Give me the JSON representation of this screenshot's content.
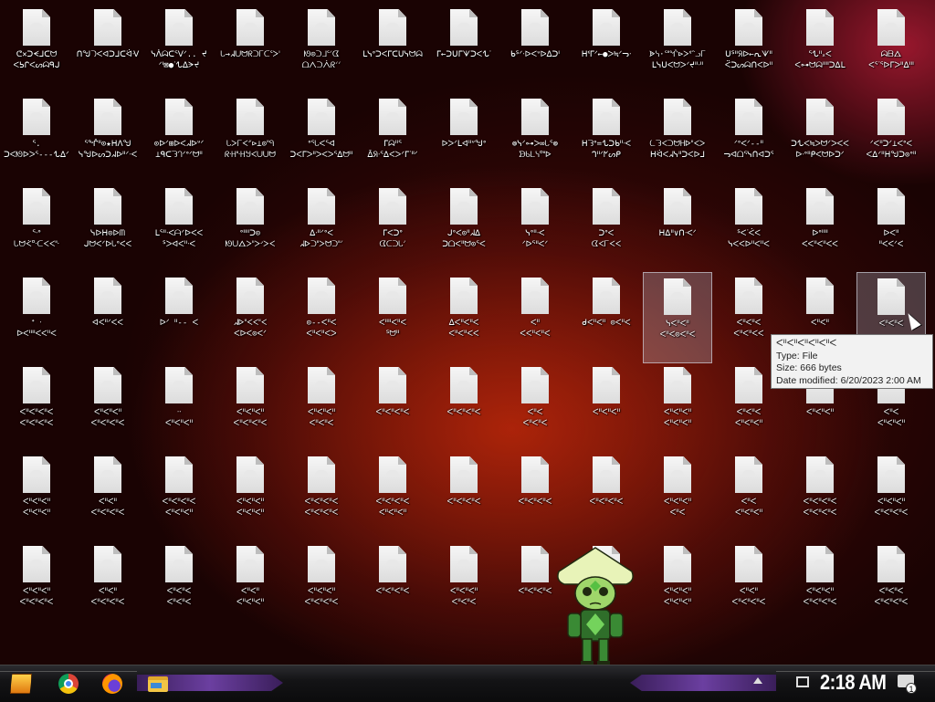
{
  "desktop": {
    "rows": [
      [
        {
          "line1": "ᕦ✕ᑐᗕᒧᑕᗢ",
          "line2": "ᐸᕊᒋᐸᔕᗣᑫᒍ"
        },
        {
          "line1": "ᑎᖑᘄᐸᐊᑐᒧᑕᐛᐺ",
          "line2": ""
        },
        {
          "line1": "ᓭᐲᗣᑕᕐᐯᐟ.. ᔪ",
          "line2": "ᐟᑊ⊠●ᐝᖍᐃᗒᔪ"
        },
        {
          "line1": "ᘂ→ᖽᑌᗢᖇᑐᒥᑕᕐᐳᑊ",
          "line2": ""
        },
        {
          "line1": "ᘚ⊙ᑐᒧᕐᐟᗧ",
          "line2": "ᗝᐱᑐᐲᖇᐟᐟ"
        },
        {
          "line1": "ᒪᓭᐤᑐᐸᒥᑕᑌᓭᗢᗣ",
          "line2": ""
        },
        {
          "line1": "ᒥ←ᑐᑌᒥᗐᑐᐸᖍᐝ",
          "line2": ""
        },
        {
          "line1": "ᑲᔆᐟᐧᐅᐸᐡᐅᐃᑐᑊ",
          "line2": ""
        },
        {
          "line1": "ᕼᓫᒥᐟ←●ᐳ≒ᐟᓓᐧ",
          "line2": ""
        },
        {
          "line1": "ᗎᓭ·ᕐᐦᖎ⊳ᐳᓫᐢᓗᒥ",
          "line2": "ᒪᓭᑌᐸᗢᐳᐟᔪᐦᐧᐦ"
        },
        {
          "line1": "ᑌᔆᐦᖆᐅ←ᕆᗐᐦ",
          "line2": "ᑈᑐᔕᗣᑎᐸᐅᐦ"
        },
        {
          "line1": "ᕐᖍᐦ᙮ᐸ",
          "line2": "ᐸ⊶ᗢᗣᐦᐦᑐᐃᒪ"
        },
        {
          "line1": "ᗣᗷᐃ",
          "line2": "ᐸᕐᐝᕐᐅᒥᐳᐦᐃᐦᑊ"
        }
      ],
      [
        {
          "line1": "ᕐ.",
          "line2": "ᑐᐸᘚᐅᐳᕐ---ᖍᐃᐟ"
        },
        {
          "line1": "ᕐᖎᐦ⊙★ᕼᐱᖑ",
          "line2": "ᓭᖑᐅᔕᑐᖽᐅᐦᐟᐧᐸ"
        },
        {
          "line1": "⊙ᐅᐟ⊞ᐅᐸᖽᐅᐡᐟ",
          "line2": "⊥ᑫᑕᘊᘃᐟᐤᐟᗢᐦ"
        },
        {
          "line1": "ᘂᐳᒥᐸᐥ⊳⊥⊙ᐦᑫ",
          "line2": "ᖇᐧᕼᐦᐧᕼᖑᐸᑌᑌᗢ"
        },
        {
          "line1": "ᐤᕐᘂᐸᕐᐊ",
          "line2": "ᑐᐸᒥᐳᐦᐳᐸᐳᕐᐃᗢᐦ"
        },
        {
          "line1": "ᒥᗣᐦᕐ",
          "line2": "ᐂᖆᐧᕐᐃᐸᐳᐟᒥᐝᐦᐟ"
        },
        {
          "line1": "ᐅᐳᐟᒪᐊᐦᐡᖑᐤ",
          "line2": ""
        },
        {
          "line1": "⊚ᓭᐟ⊶ᐳ∞ᘂᕐ⊚",
          "line2": "ᗦᑲᒪᓭᐤᐦᐅ"
        },
        {
          "line1": "ᕼᘊᐤ=ᖍᑐᑲᐦᐧᐸ",
          "line2": "ᒉᐦᐟᖼᔕᑭ"
        },
        {
          "line1": "ᘇᘊᐸᑐᗢᕼᐅᐦᐸᐳ",
          "line2": "ᕼᐛᐸᖽᓭᐦᑐᐸᐅᒧ"
        },
        {
          "line1": "ᐟᐤᐸᐟ--ᐦ",
          "line2": "ᓓᐊᗝᕐᓭᑎᐊᑐᕐ"
        },
        {
          "line1": "ᑐᖍᐸ≒ᐳᗢᐟᐳᐸᐸ",
          "line2": "ᐅᐧᐤᐦᑭᐸᗢᐅᑐᐟ"
        },
        {
          "line1": "ᐟᐸᐦᑐᐟ⊥ᐸᐤᐸ",
          "line2": "ᐸᐃᐟᐦᕼᖑᑐ⊙ᐤᐦ"
        }
      ],
      [
        {
          "line1": "ᕐᐧᐤ",
          "line2": "ᘂᗢᐹᐤᐧᑕᐸᐸᐦᐧ"
        },
        {
          "line1": "ᓭᐅᕼ⊙ᐅᗰ",
          "line2": "ᒍᗢᐸᐟᐅᘂᐤᐸᐸ"
        },
        {
          "line1": "ᒪᕐᐦᐧᐸᗩᐟᐅᐸᐸ",
          "line2": "ᔆᐳᐊᐸᐦᐧᐸ"
        },
        {
          "line1": "ᐤᐦᐦᑐ⊙",
          "line2": "ᘚᑌᐃᐳᐦᐳᐝᐳᐸ"
        },
        {
          "line1": "ᐃᐧᐦᐟᐤᐸ",
          "line2": "ᖽᐅᑐᐦᐳᗢᑐᐦᐟ"
        },
        {
          "line1": "ᒥᐸᑐᐤ",
          "line2": "ᗧᑕᑐᘂᐟ"
        },
        {
          "line1": "ᒍᐤᐸ⊙ᐦᖽᐃ",
          "line2": "ᑐᗝᐸᐦᗢ⊙ᕐᐸ"
        },
        {
          "line1": "ᓭᐤᐦᐧᐸ",
          "line2": "ᐟᐅᕐᐦᐸᐟ"
        },
        {
          "line1": "ᑐᐤᐸ",
          "line2": "ᗧᐸᒥᐸᐸ"
        },
        {
          "line1": "ᕼᐃᐦ∨ᑎᐧᐸᐟ",
          "line2": ""
        },
        {
          "line1": "ᔆᐸᐝᐹᐸ",
          "line2": "ᓭᐸᐸᐅᐦᐸᐦᐸ"
        },
        {
          "line1": "ᐅᐤᐦᐦ",
          "line2": "ᐸᐸᐦᐸᐦᐸᐸ"
        },
        {
          "line1": "ᐅᐸᐦ",
          "line2": "ᐦᐸᐸᐟᐸ"
        }
      ],
      [
        {
          "line1": "ᐩ ᐧ",
          "line2": "ᐅᐸᐦᐦᐸᐸᐦᐸ"
        },
        {
          "line1": "ᐊᐸᐦᐟᐸᐸ",
          "line2": ""
        },
        {
          "line1": "ᐅᐟ ᐦ-- ᐸ",
          "line2": ""
        },
        {
          "line1": "ᖽᐅᐦᐸᐸᐦᐸ",
          "line2": "ᐸᐅᐸ⊙ᐸᐟ"
        },
        {
          "line1": "⊙--ᐸᐦᐸ",
          "line2": "ᐸᐦᐸᐦᐸᐳ"
        },
        {
          "line1": "ᐸᐦᐦᐸᐦᐸ",
          "line2": "ᔆᗢᐦ"
        },
        {
          "line1": "ᐃᐸᐦᐸᐦᐸ",
          "line2": "ᐸᐦᐸᐦᐸᐸ"
        },
        {
          "line1": "ᐸᐦ",
          "line2": "ᐸᐸᐦᐸᐦᐸ"
        },
        {
          "line1": "ᑯᐸᐦᐸᐦ ⊙ᐸᐦᐸ",
          "line2": ""
        },
        {
          "line1": "ᓭᐸᐦᐸᐦ",
          "line2": "ᐸᐦᐸ⊙ᐸᐦᐸ"
        },
        {
          "line1": "ᐸᐦᐸᐦᐸ",
          "line2": "ᐸᐦᐸᐦᐸᐸ"
        },
        {
          "line1": "ᐸᐦᐸᐦ",
          "line2": ""
        },
        {
          "line1": "ᐸᐦᐸᐦᐸ",
          "line2": ""
        }
      ],
      [
        {
          "line1": "ᐸᐦᐸᐦᐸᐦᐸ",
          "line2": "ᐸᐦᐸᐦᐸᐦᐸ"
        },
        {
          "line1": "ᐸᐦᐸᐦᐸᐦ",
          "line2": "ᐸᐦᐸᐦᐸᐦᐸ"
        },
        {
          "line1": "ᐧᐧ",
          "line2": "ᐸᐦᐸᐦᐸᐦ"
        },
        {
          "line1": "ᐸᐦᐸᐦᐸᐦ",
          "line2": "ᐸᐦᐸᐦᐸᐦᐸ"
        },
        {
          "line1": "ᐸᐦᐸᐦᐸᐦ",
          "line2": "ᐸᐦᐸᐦᐸ"
        },
        {
          "line1": "ᐸᐦᐸᐦᐸᐦᐸ",
          "line2": ""
        },
        {
          "line1": "ᐸᐦᐸᐦᐸᐦᐸ",
          "line2": ""
        },
        {
          "line1": "ᐸᐦᐸ",
          "line2": "ᐸᐦᐸᐦᐸ"
        },
        {
          "line1": "ᐸᐦᐸᐦᐸᐦ",
          "line2": ""
        },
        {
          "line1": "ᐸᐦᐸᐦᐸᐦ",
          "line2": "ᐸᐦᐸᐦᐸᐦ"
        },
        {
          "line1": "ᐸᐦᐸᐦᐸ",
          "line2": "ᐸᐦᐸᐦᐸᐦ"
        },
        {
          "line1": "ᐸᐦᐸᐦᐸᐦ",
          "line2": ""
        },
        {
          "line1": "ᐸᐦᐸ",
          "line2": "ᐸᐦᐸᐦᐸᐦ"
        }
      ],
      [
        {
          "line1": "ᐸᐦᐸᐦᐸᐦ",
          "line2": "ᐸᐦᐸᐦᐸᐦ"
        },
        {
          "line1": "ᐸᐦᐸᐦ",
          "line2": "ᐸᐦᐸᐦᐸᐦᐸ"
        },
        {
          "line1": "ᐸᐦᐸᐦᐸᐦᐸ",
          "line2": "ᐸᐦᐸᐦᐸᐦ"
        },
        {
          "line1": "ᐸᐦᐸᐦᐸᐦ",
          "line2": "ᐸᐦᐸᐦᐸᐦ"
        },
        {
          "line1": "ᐸᐦᐸᐦᐸᐦᐸ",
          "line2": "ᐸᐦᐸᐦᐸᐦᐸ"
        },
        {
          "line1": "ᐸᐦᐸᐦᐸᐦᐸ",
          "line2": "ᐸᐦᐸᐦᐸᐦ"
        },
        {
          "line1": "ᐸᐦᐸᐦᐸᐦᐸ",
          "line2": ""
        },
        {
          "line1": "ᐸᐦᐸᐦᐸᐦᐸ",
          "line2": ""
        },
        {
          "line1": "ᐸᐦᐸᐦᐸᐦᐸ",
          "line2": ""
        },
        {
          "line1": "ᐸᐦᐸᐦᐸᐦ",
          "line2": "ᐸᐦᐸ"
        },
        {
          "line1": "ᐸᐦᐸ",
          "line2": "ᐸᐦᐸᐦᐸᐦ"
        },
        {
          "line1": "ᐸᐦᐸᐦᐸᐦᐸ",
          "line2": "ᐸᐦᐸᐦᐸᐦᐸ"
        },
        {
          "line1": "ᐸᐦᐸᐦᐸᐦ",
          "line2": "ᐸᐦᐸᐦᐸᐦᐸ"
        }
      ],
      [
        {
          "line1": "ᐸᐦᐸᐦᐸᐦ",
          "line2": "ᐸᐦᐸᐦᐸᐦᐸ"
        },
        {
          "line1": "ᐸᐦᐸᐦ",
          "line2": "ᐸᐦᐸᐦᐸᐦᐸ"
        },
        {
          "line1": "ᐸᐦᐸᐦᐸ",
          "line2": "ᐸᐦᐸᐦᐸ"
        },
        {
          "line1": "ᐸᐦᐸᐦ",
          "line2": "ᐸᐦᐸᐦᐸᐦ"
        },
        {
          "line1": "ᐸᐦᐸᐦᐸᐦ",
          "line2": "ᐸᐦᐸᐦᐸᐦᐸ"
        },
        {
          "line1": "ᐸᐦᐸᐦᐸᐦᐸ",
          "line2": ""
        },
        {
          "line1": "ᐸᐦᐸᐦᐸᐦ",
          "line2": "ᐸᐦᐸᐦᐸ"
        },
        {
          "line1": "ᐸᐦᐸᐦᐸᐦᐸ",
          "line2": ""
        },
        {
          "line1": "",
          "line2": ""
        },
        {
          "line1": "ᐸᐦᐸᐦᐸᐦ",
          "line2": "ᐸᐦᐸᐦᐸᐦ"
        },
        {
          "line1": "ᐸᐦᐸᐦ",
          "line2": "ᐸᐦᐸᐦᐸᐦᐸ"
        },
        {
          "line1": "ᐸᐦᐸᐦᐸᐦ",
          "line2": "ᐸᐦᐸᐦᐸᐦᐸ"
        },
        {
          "line1": "ᐸᐦᐸᐦᐸ",
          "line2": "ᐸᐦᐸᐦᐸᐦᐸ"
        }
      ]
    ],
    "selected": [
      [
        3,
        9
      ],
      [
        3,
        12
      ]
    ]
  },
  "tooltip": {
    "title": "ᐸᐦᐸᐦᐸᐦᐸᐦᐸᐦᐸ",
    "type_line": "Type: File",
    "size_line": "Size: 666 bytes",
    "date_line": "Date modified: 6/20/2023 2:00 AM"
  },
  "taskbar": {
    "clock": "2:18 AM",
    "notification_count": "1",
    "pinned": [
      "start-icon",
      "chrome-icon",
      "firefox-icon",
      "file-explorer-icon"
    ]
  },
  "colors": {
    "accent_purple": "#6b3fa0",
    "background_red": "#4a0a08"
  }
}
